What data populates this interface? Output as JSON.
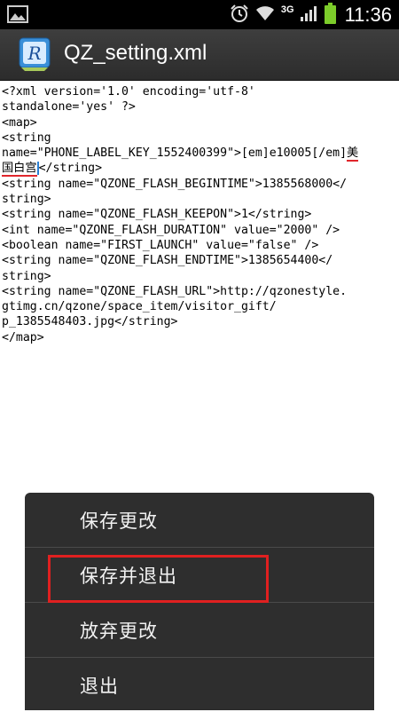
{
  "status_bar": {
    "time": "11:36",
    "network": "3G",
    "icons": [
      "gallery-icon",
      "alarm-icon",
      "wifi-icon",
      "signal-icon",
      "battery-icon"
    ]
  },
  "title_bar": {
    "title": "QZ_setting.xml",
    "app_icon_letter": "R"
  },
  "editor": {
    "lines": [
      "<?xml version='1.0' encoding='utf-8'",
      "standalone='yes' ?>",
      "<map>",
      "<string",
      "name=\"PHONE_LABEL_KEY_1552400399\">[em]e10005[/em]",
      "</string>",
      "<string name=\"QZONE_FLASH_BEGINTIME\">1385568000</",
      "string>",
      "<string name=\"QZONE_FLASH_KEEPON\">1</string>",
      "<int name=\"QZONE_FLASH_DURATION\" value=\"2000\" />",
      "<boolean name=\"FIRST_LAUNCH\" value=\"false\" />",
      "<string name=\"QZONE_FLASH_ENDTIME\">1385654400</",
      "string>",
      "<string name=\"QZONE_FLASH_URL\">http://qzonestyle.",
      "gtimg.cn/qzone/space_item/visitor_gift/",
      "p_1385548403.jpg</string>",
      "</map>"
    ],
    "highlight_part1": "美",
    "highlight_part2": "国白宫"
  },
  "menu": {
    "items": [
      {
        "label": "保存更改"
      },
      {
        "label": "保存并退出"
      },
      {
        "label": "放弃更改"
      },
      {
        "label": "退出"
      }
    ]
  },
  "colors": {
    "annotation_red": "#e02020",
    "menu_bg": "#2e2e2e",
    "titlebar_bg": "#333333"
  }
}
